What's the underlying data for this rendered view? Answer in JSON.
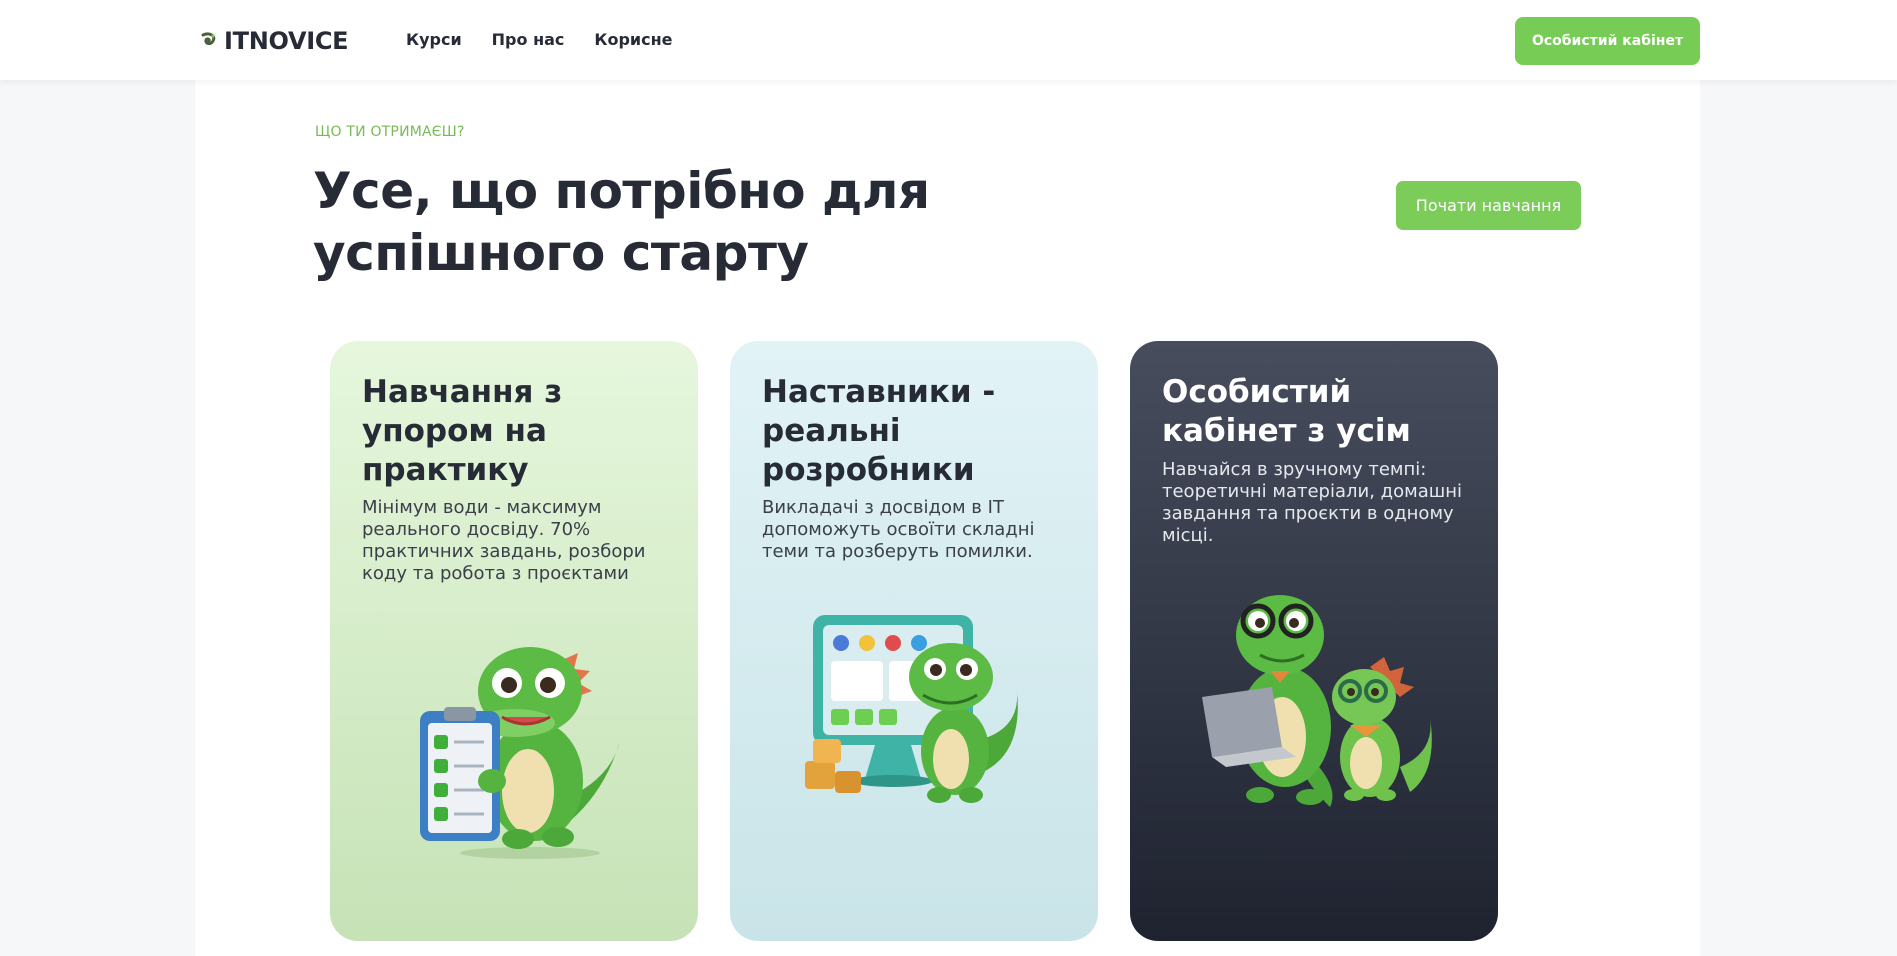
{
  "header": {
    "logo_text": "ITNOVICE",
    "nav": [
      "Курси",
      "Про нас",
      "Корисне"
    ],
    "cabinet_button": "Особистий кабінет"
  },
  "section": {
    "eyebrow": "ЩО ТИ ОТРИМАЄШ?",
    "title_line1": "Усе, що потрібно для",
    "title_line2": "успішного старту",
    "start_button": "Почати навчання"
  },
  "cards": [
    {
      "title": "Навчання з упором на практику",
      "text": "Мінімум води - максимум реального досвіду. 70% практичних завдань, розбори коду та робота з проєктами",
      "illustration": "dino-checklist-icon"
    },
    {
      "title": "Наставники - реальні розробники",
      "text": "Викладачі з досвідом в IT допоможуть освоїти складні теми та розберуть помилки.",
      "illustration": "dino-computer-icon"
    },
    {
      "title": "Особистий кабінет з усім",
      "text": "Навчайся в зручному темпі: теоретичні матеріали, домашні завдання та проєкти в одному місці.",
      "illustration": "dino-laptop-icon"
    }
  ],
  "colors": {
    "accent": "#77cc55",
    "text": "#262b36",
    "card1": "#dff2d4",
    "card2": "#d6edf1",
    "card3": "#343a48"
  }
}
